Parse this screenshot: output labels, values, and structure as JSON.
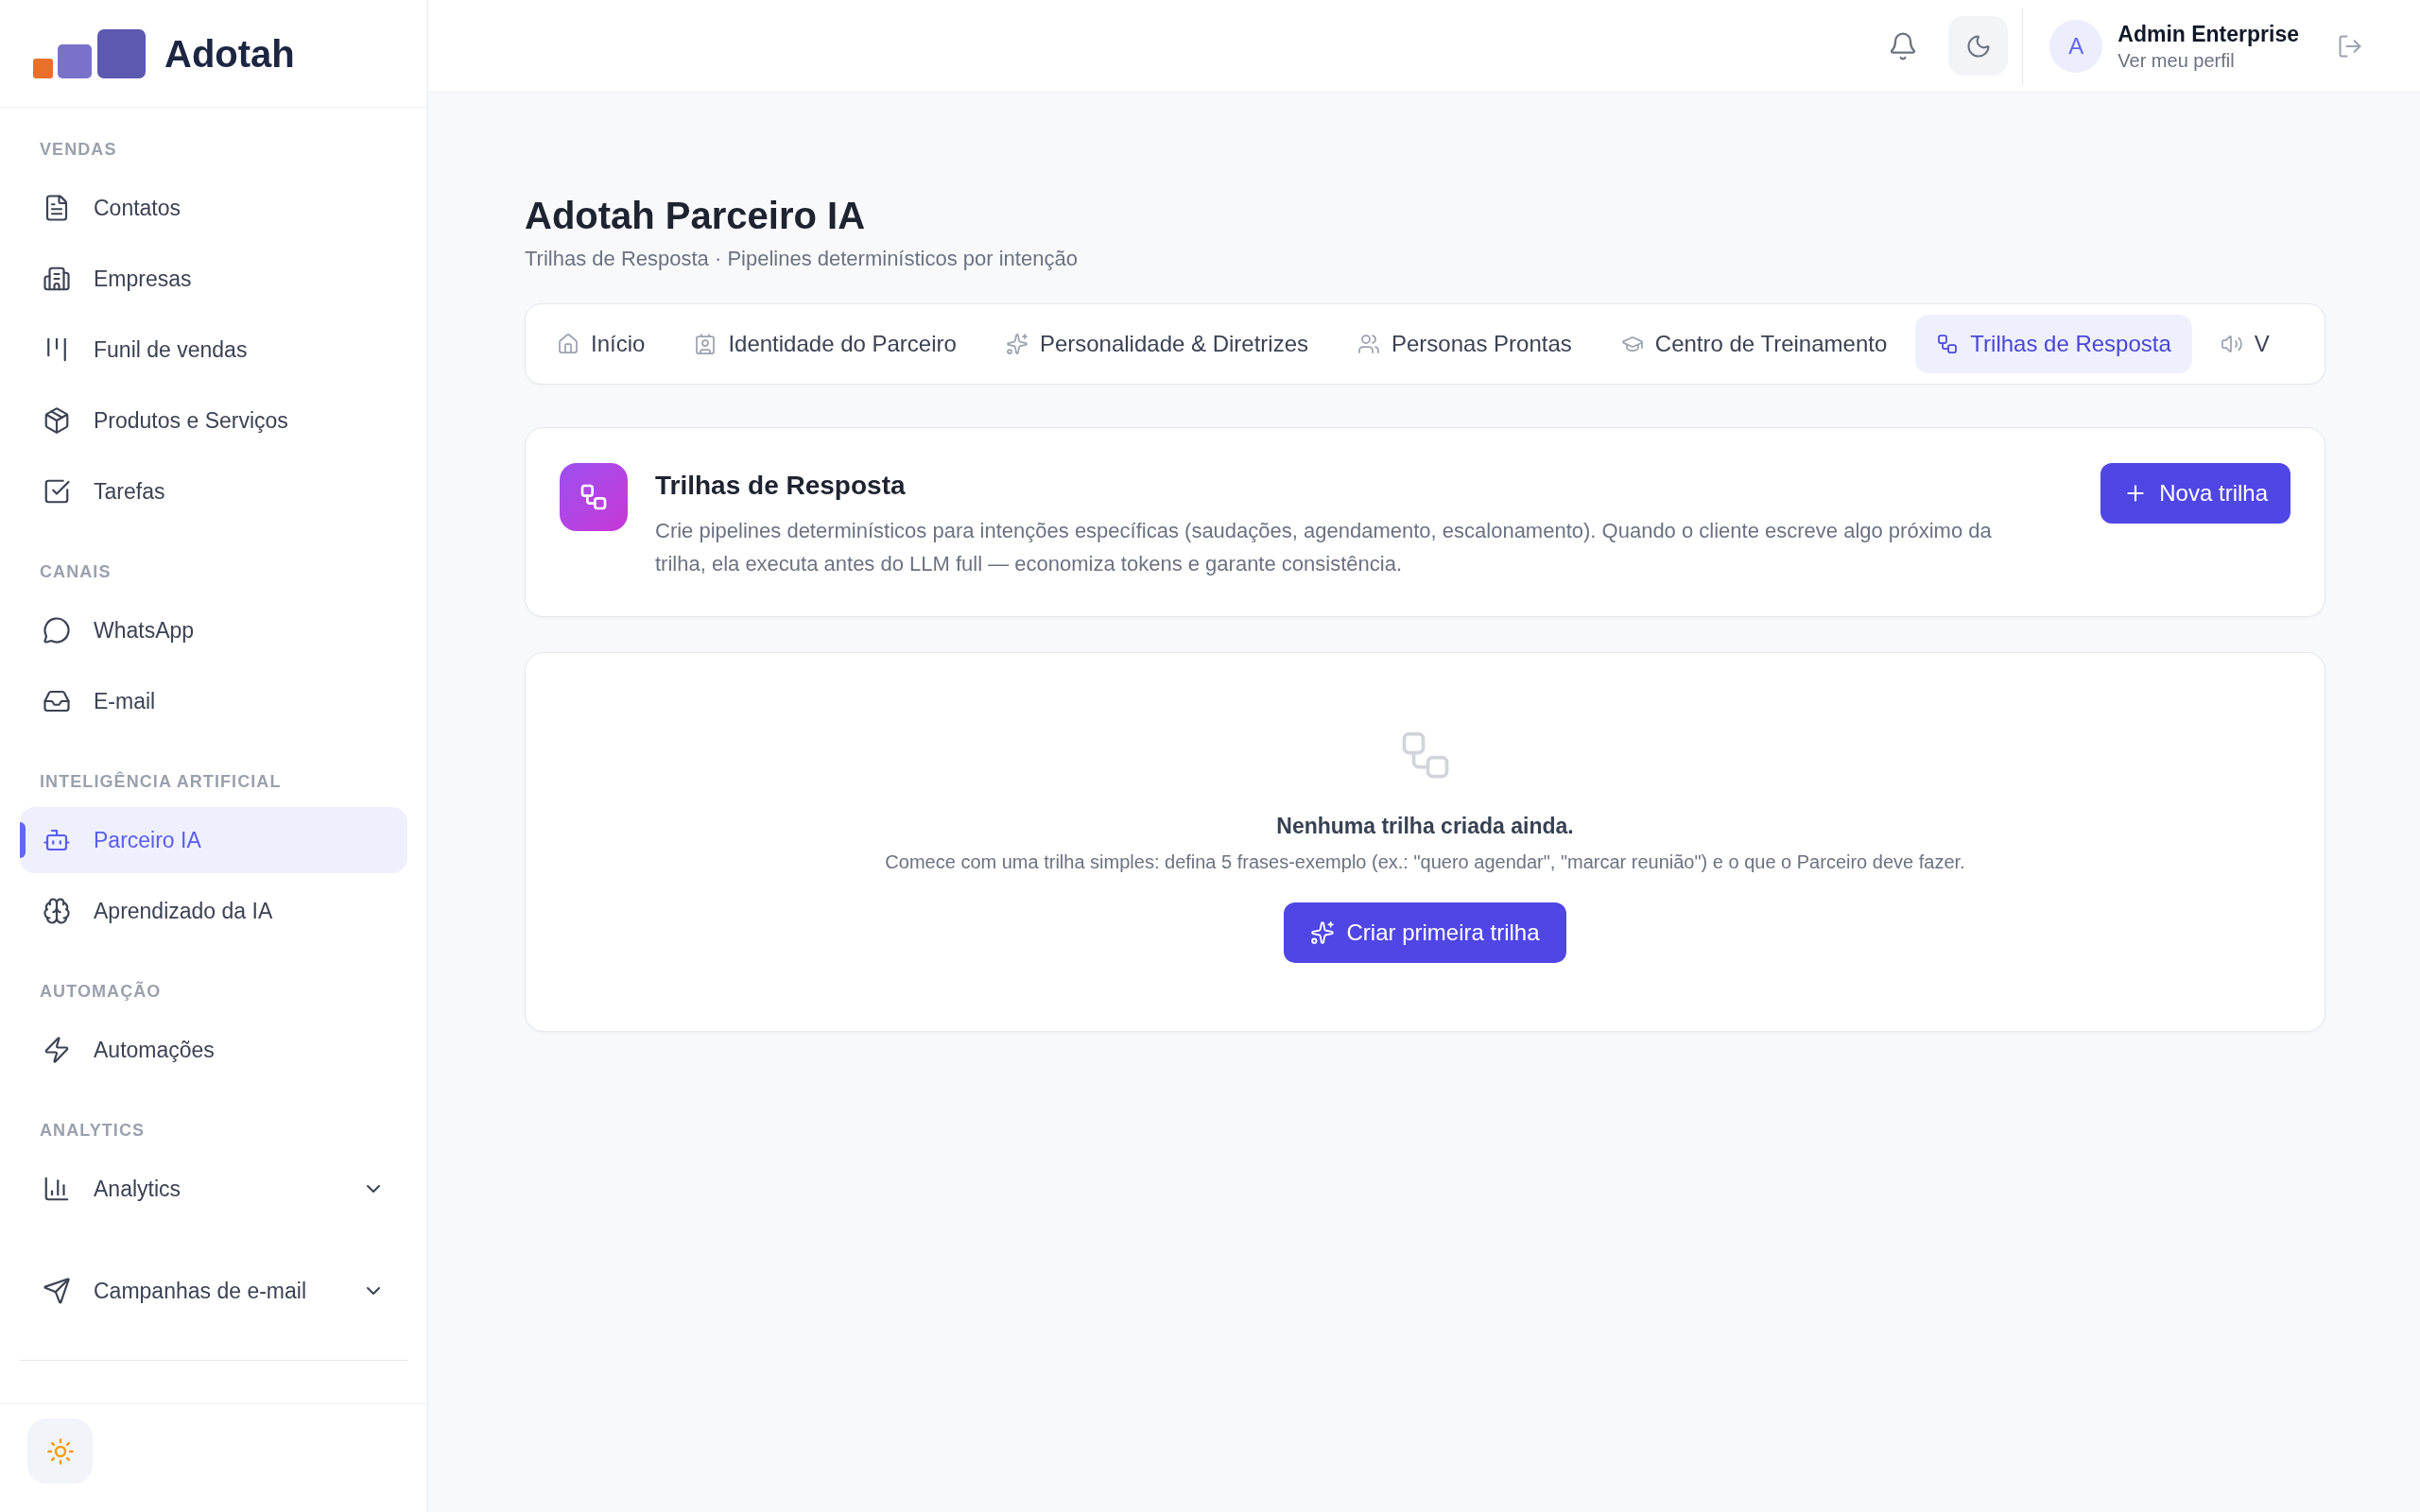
{
  "sidebar": {
    "brand": "Adotah",
    "sections": [
      {
        "heading": "VENDAS",
        "items": [
          {
            "kind": "link",
            "label": "Contatos",
            "selected": false
          },
          {
            "kind": "link",
            "label": "Empresas",
            "selected": false
          },
          {
            "kind": "link",
            "label": "Funil de vendas",
            "selected": false
          },
          {
            "kind": "link",
            "label": "Produtos e Serviços",
            "selected": false
          },
          {
            "kind": "link",
            "label": "Tarefas",
            "selected": false
          }
        ]
      },
      {
        "heading": "CANAIS",
        "items": [
          {
            "kind": "link",
            "label": "WhatsApp",
            "selected": false
          },
          {
            "kind": "link",
            "label": "E-mail",
            "selected": false
          }
        ]
      },
      {
        "heading": "INTELIGÊNCIA ARTIFICIAL",
        "items": [
          {
            "kind": "link",
            "label": "Parceiro IA",
            "selected": true
          },
          {
            "kind": "link",
            "label": "Aprendizado da IA",
            "selected": false
          }
        ]
      },
      {
        "heading": "AUTOMAÇÃO",
        "items": [
          {
            "kind": "link",
            "label": "Automações",
            "selected": false
          }
        ]
      },
      {
        "heading": "ANALYTICS",
        "items": [
          {
            "kind": "group",
            "label": "Analytics",
            "selected": false,
            "expanded": false
          }
        ]
      },
      {
        "items": [
          {
            "kind": "group",
            "label": "Campanhas de e-mail",
            "selected": false,
            "expanded": false
          }
        ]
      }
    ]
  },
  "header": {
    "user": {
      "avatar_initial": "A",
      "name": "Admin Enterprise",
      "profile_link": "Ver meu perfil"
    }
  },
  "page": {
    "title": "Adotah Parceiro IA",
    "subtitle": "Trilhas de Resposta · Pipelines determinísticos por intenção"
  },
  "tabs": [
    {
      "label": "Início",
      "selected": false
    },
    {
      "label": "Identidade do Parceiro",
      "selected": false
    },
    {
      "label": "Personalidade & Diretrizes",
      "selected": false
    },
    {
      "label": "Personas Prontas",
      "selected": false
    },
    {
      "label": "Centro de Treinamento",
      "selected": false
    },
    {
      "label": "Trilhas de Resposta",
      "selected": true
    },
    {
      "label": "V",
      "selected": false
    }
  ],
  "intro_card": {
    "title": "Trilhas de Resposta",
    "description": "Crie pipelines determinísticos para intenções específicas (saudações, agendamento, escalonamento). Quando o cliente escreve algo próximo da trilha, ela executa antes do LLM full — economiza tokens e garante consistência.",
    "button": "Nova trilha"
  },
  "empty_state": {
    "title": "Nenhuma trilha criada ainda.",
    "message": "Comece com uma trilha simples: defina 5 frases-exemplo (ex.: \"quero agendar\", \"marcar reunião\") e o que o Parceiro deve fazer.",
    "button": "Criar primeira trilha"
  }
}
